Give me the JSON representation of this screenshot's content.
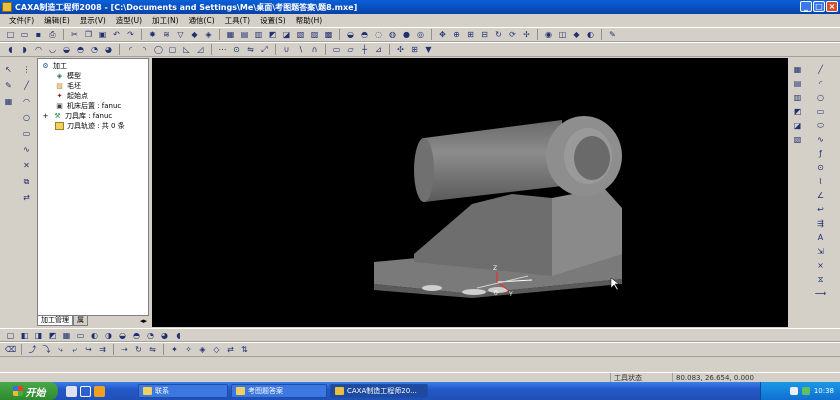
{
  "window": {
    "title": "CAXA制造工程师2008  - [C:\\Documents and Settings\\Me\\桌面\\考图题答案\\题8.mxe]",
    "min": "_",
    "max": "□",
    "close": "×"
  },
  "menu": [
    "文件(F)",
    "编辑(E)",
    "显示(V)",
    "造型(U)",
    "加工(N)",
    "通信(C)",
    "工具(T)",
    "设置(S)",
    "帮助(H)"
  ],
  "tree": {
    "root": "加工",
    "items": [
      {
        "label": "模型",
        "icon": "model-icon"
      },
      {
        "label": "毛坯",
        "icon": "blank-icon"
      },
      {
        "label": "起始点",
        "icon": "start-point-icon"
      },
      {
        "label": "机床后置 : fanuc",
        "icon": "machine-post-icon"
      },
      {
        "label": "刀具库 : fanuc",
        "icon": "tool-library-icon"
      },
      {
        "label": "刀具轨迹 : 共 0 条",
        "icon": "toolpath-icon"
      }
    ],
    "expand": "+"
  },
  "tabs": [
    "加工管理",
    "属"
  ],
  "viewport": {
    "axis_z": "Z",
    "axis_y": "Y",
    "origin": "0"
  },
  "status": {
    "label": "工具状态",
    "coords": "80.083, 26.654, 0.000"
  },
  "taskbar": {
    "start": "开始",
    "tasks": [
      "联系",
      "考图题答案",
      "CAXA制造工程师20..."
    ],
    "clock": "10:38"
  },
  "colors": {
    "titlebar": "#0842a8",
    "viewport_bg": "#000000",
    "model_gray": "#808080",
    "taskbar": "#2458c8"
  }
}
